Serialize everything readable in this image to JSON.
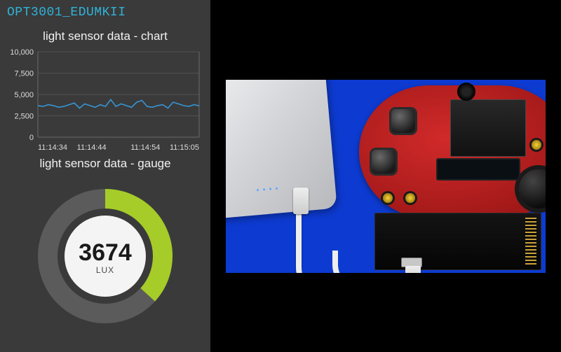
{
  "title": "OPT3001_EDUMKII",
  "chart": {
    "header": "light sensor data - chart",
    "y_ticks": [
      "10,000",
      "7,500",
      "5,000",
      "2,500",
      "0"
    ],
    "x_ticks": [
      "11:14:34",
      "11:14:44",
      "11:14:54",
      "11:15:05"
    ],
    "y_max": 10000
  },
  "gauge": {
    "header": "light sensor data - gauge",
    "value": "3674",
    "value_num": 3674,
    "max": 10000,
    "unit": "LUX"
  },
  "chart_data": {
    "type": "line",
    "title": "light sensor data - chart",
    "xlabel": "",
    "ylabel": "",
    "ylim": [
      0,
      10000
    ],
    "series": [
      {
        "name": "light sensor",
        "x": [
          "11:14:34",
          "11:14:35",
          "11:14:36",
          "11:14:37",
          "11:14:38",
          "11:14:39",
          "11:14:40",
          "11:14:41",
          "11:14:42",
          "11:14:43",
          "11:14:44",
          "11:14:45",
          "11:14:46",
          "11:14:47",
          "11:14:48",
          "11:14:49",
          "11:14:50",
          "11:14:51",
          "11:14:52",
          "11:14:53",
          "11:14:54",
          "11:14:55",
          "11:14:56",
          "11:14:57",
          "11:14:58",
          "11:14:59",
          "11:15:00",
          "11:15:01",
          "11:15:02",
          "11:15:03",
          "11:15:04",
          "11:15:05"
        ],
        "values": [
          3700,
          3600,
          3800,
          3700,
          3500,
          3600,
          3800,
          4000,
          3400,
          3900,
          3700,
          3500,
          3800,
          3600,
          4400,
          3600,
          3900,
          3700,
          3500,
          4100,
          4300,
          3600,
          3500,
          3700,
          3800,
          3400,
          4100,
          3900,
          3700,
          3600,
          3800,
          3674
        ]
      }
    ]
  }
}
